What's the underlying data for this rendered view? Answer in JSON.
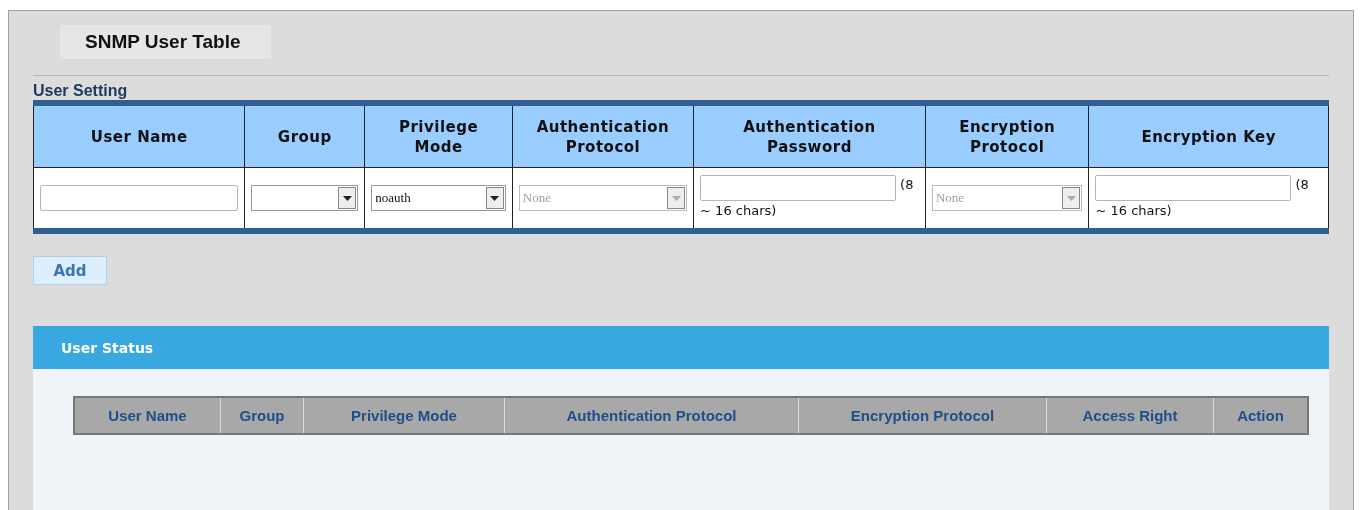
{
  "page_title": "SNMP User Table",
  "user_setting": {
    "title": "User Setting",
    "columns": [
      "User Name",
      "Group",
      "Privilege Mode",
      "Authentication Protocol",
      "Authentication Password",
      "Encryption Protocol",
      "Encryption Key"
    ],
    "row": [
      {
        "kind": "text"
      },
      {
        "kind": "select",
        "disabled": false
      },
      {
        "kind": "select",
        "value": "noauth",
        "disabled": false
      },
      {
        "kind": "select",
        "value": "None",
        "disabled": true
      },
      {
        "kind": "password",
        "hint_start": "(8",
        "hint_end": "~ 16 chars)"
      },
      {
        "kind": "select",
        "value": "None",
        "disabled": true
      },
      {
        "kind": "password",
        "hint_start": "(8",
        "hint_end": "~ 16 chars)"
      }
    ]
  },
  "add_button": "Add",
  "user_status": {
    "title": "User Status",
    "columns": [
      "User Name",
      "Group",
      "Privilege Mode",
      "Authentication Protocol",
      "Encryption Protocol",
      "Access Right",
      "Action"
    ]
  }
}
